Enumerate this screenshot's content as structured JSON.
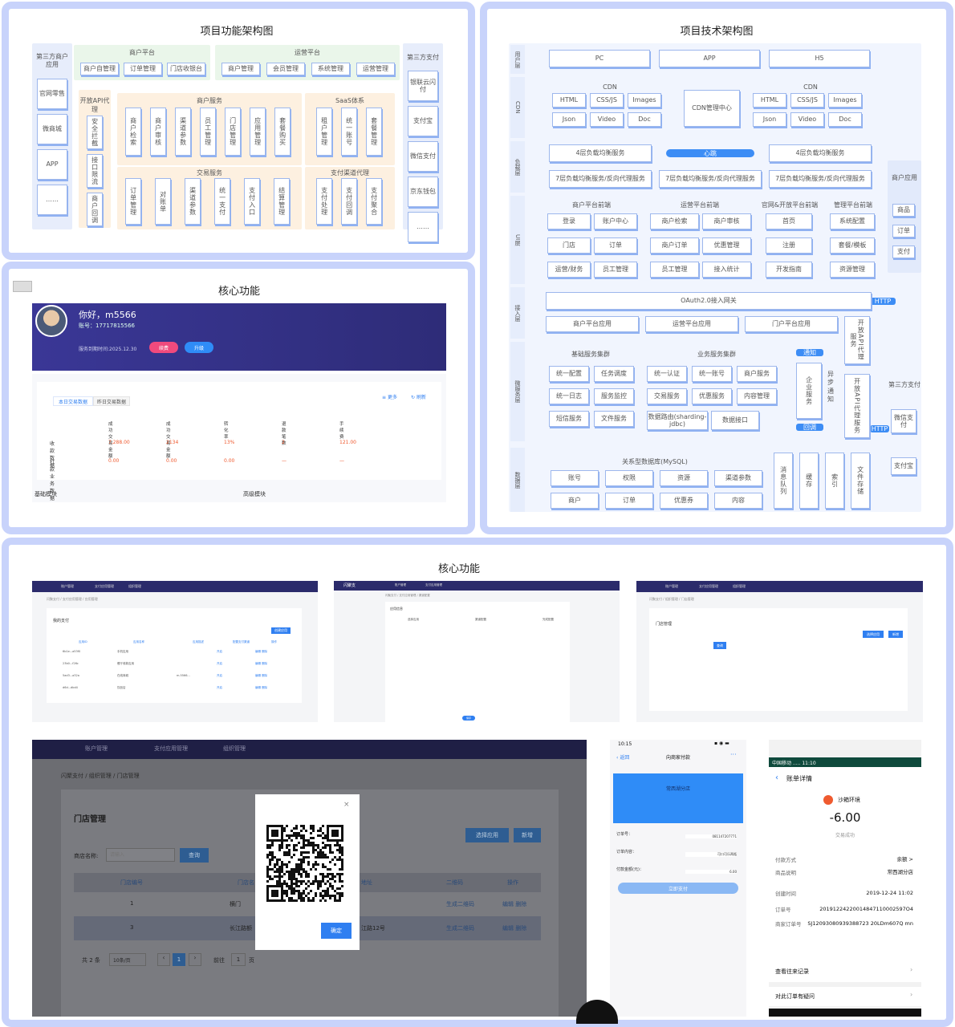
{
  "func": {
    "title": "项目功能架构图",
    "third": "第三方商户应用",
    "third_items": [
      "官网零售",
      "微商城",
      "APP",
      "……"
    ],
    "merchant_platform": "商户平台",
    "mp_items": [
      "商户自管理",
      "订单管理",
      "门店收银台"
    ],
    "ops_platform": "运营平台",
    "op_items": [
      "商户管理",
      "会员管理",
      "系统管理",
      "运营管理"
    ],
    "pay3": "第三方支付",
    "pay3_items": [
      "银联云闪付",
      "支付宝",
      "微信支付",
      "京东钱包",
      "……"
    ],
    "openapi": "开放API代理",
    "openapi_items": [
      "安全拦截",
      "接口限流",
      "商户回调"
    ],
    "merchant_service": "商户服务",
    "ms_items": [
      "商户检索",
      "商户审核",
      "渠道参数",
      "员工管理",
      "门店管理",
      "应用管理",
      "套餐购买"
    ],
    "saas": "SaaS体系",
    "saas_items": [
      "租户管理",
      "统一账号",
      "套餐管理"
    ],
    "trade": "交易服务",
    "trade_items": [
      "订单管理",
      "对账单",
      "渠道参数",
      "统一支付",
      "支付入口",
      "结算管理"
    ],
    "channel": "支付渠道代理",
    "channel_items": [
      "支付处理",
      "支付回调",
      "支付聚合"
    ]
  },
  "tech": {
    "title": "项目技术架构图",
    "layers": [
      "用户层",
      "CDN",
      "负载层",
      "UI层",
      "接入层",
      "微服务层",
      "数据层"
    ],
    "users": [
      "PC",
      "APP",
      "H5"
    ],
    "cdn_label": "CDN",
    "cdn_items": [
      "HTML",
      "CSS/JS",
      "Images",
      "Json",
      "Video",
      "Doc"
    ],
    "cdn_center": "CDN管理中心",
    "lb4": "4层负载均衡服务",
    "heartbeat": "心跳",
    "lb7": "7层负载均衡服务/反向代理服务",
    "ui_groups": [
      {
        "name": "商户平台前端",
        "items": [
          "登录",
          "账户中心",
          "门店",
          "订单",
          "运营/财务",
          "员工管理"
        ]
      },
      {
        "name": "运营平台前端",
        "items": [
          "商户检索",
          "商户审核",
          "商户订单",
          "优惠管理",
          "员工管理",
          "接入统计"
        ]
      },
      {
        "name": "官网&开放平台前端",
        "items": [
          "首页",
          "注册",
          "开发指南"
        ]
      },
      {
        "name": "管理平台前端",
        "items": [
          "系统配置",
          "套餐/模板",
          "资源管理"
        ]
      }
    ],
    "merchant_app": "商户应用",
    "app_items": [
      "商品",
      "订单",
      "支付"
    ],
    "oauth": "OAuth2.0接入网关",
    "http": "HTTP",
    "access": [
      "商户平台应用",
      "运营平台应用",
      "门户平台应用"
    ],
    "openapi_proxy": "开放API代理服务",
    "base_cluster": "基础服务集群",
    "base_items": [
      "统一配置",
      "任务调度",
      "统一日志",
      "服务监控",
      "短信服务",
      "文件服务"
    ],
    "biz_cluster": "业务服务集群",
    "biz_items": [
      "统一认证",
      "统一账号",
      "商户服务",
      "交易服务",
      "优惠服务",
      "内容管理",
      "数据路由(sharding-jdbc)",
      "数据接口"
    ],
    "enterprise": "企业服务",
    "async": "异步通知",
    "notice": "通知",
    "callback": "回调",
    "pay3": "第三方支付",
    "pay3_items": [
      "微信支付",
      "支付宝"
    ],
    "db": "关系型数据库(MySQL)",
    "db_items": [
      "账号",
      "权限",
      "资源",
      "渠道参数",
      "商户",
      "订单",
      "优惠券",
      "内容"
    ],
    "stores": [
      "消息队列",
      "缓存",
      "索引",
      "文件存储"
    ]
  },
  "core": {
    "title": "核心功能",
    "greeting": "你好，m5566",
    "account": "账号：17717815566",
    "expire": "服务到期时间:2025.12.30",
    "renew": "续费",
    "upgrade": "升级",
    "tabs": [
      "本日交易数据",
      "昨日交易数据"
    ],
    "more": "更多",
    "refresh": "刷新",
    "cols": [
      "成功交易金额",
      "成功交易金额",
      "转化率",
      "退款笔数",
      "手续费"
    ],
    "rows": [
      {
        "name": "收款数据",
        "vals": [
          "7,288.00",
          "2134",
          "13%",
          "2",
          "121.00"
        ]
      },
      {
        "name": "打款业务数据",
        "vals": [
          "0.00",
          "0.00",
          "0.00",
          "—",
          "—"
        ]
      }
    ],
    "left_module": "基础模块",
    "right_module": "高级模块"
  },
  "bottom": {
    "title": "核心功能",
    "shot1": {
      "nav": [
        "账户管理",
        "支付应用管理",
        "组织管理"
      ],
      "crumb": "闪聚支付 / 支付应用管理 / 应用管理",
      "heading": "我的支付",
      "create": "创建应用",
      "cols": [
        "应用ID",
        "应用名称",
        "应用描述",
        "配置支付渠道",
        "操作"
      ],
      "rows": [
        [
          "6b1e...a53f0",
          "手机应用",
          "",
          "开启",
          "编辑 删除"
        ],
        [
          "23b0...f26c",
          "餐厅收款应用",
          "",
          "开启",
          "编辑 删除"
        ],
        [
          "5ad3...a32a",
          "在线商城",
          "m.5566...",
          "开启",
          "编辑 删除"
        ],
        [
          "d6d...dbd4",
          "饮品店",
          "",
          "开启",
          "编辑 删除"
        ]
      ]
    },
    "shot2": {
      "logo": "闪聚支",
      "nav": [
        "账户管理",
        "支付应用管理"
      ],
      "crumb": "闪聚支付 / 支付应用管理 / 渠道配置",
      "heading": "应用信息",
      "steps": [
        "选择应用",
        "渠道配置",
        "完成配置"
      ],
      "button": "保存"
    },
    "shot3": {
      "nav": [
        "账户管理",
        "支付应用管理",
        "组织管理"
      ],
      "crumb": "闪聚支付 / 组织管理 / 门店管理",
      "heading": "门店管理",
      "btns": [
        "选择应用",
        "新增"
      ],
      "search": "查询"
    },
    "store": {
      "nav": [
        "账户管理",
        "支付应用管理",
        "组织管理"
      ],
      "crumb": "闪聚支付 / 组织管理 / 门店管理",
      "heading": "门店管理",
      "label": "商店名称:",
      "placeholder": "请输入",
      "search": "查询",
      "select_app": "选择应用",
      "add": "新增",
      "cols": [
        "门店编号",
        "门店名",
        "地址",
        "二维码",
        "操作"
      ],
      "rows": [
        [
          "1",
          "横门",
          "",
          "生成二维码",
          "编辑 删除"
        ],
        [
          "3",
          "长江路额",
          "江路12号",
          "生成二维码",
          "编辑 删除"
        ]
      ],
      "total": "共 2 条",
      "per": "10条/页",
      "page": "1",
      "goto": "前往",
      "goto_val": "1",
      "unit": "页",
      "confirm": "确定"
    },
    "mobile": {
      "time": "10:15",
      "back": "返回",
      "title": "向商家付款",
      "shop": "常西湖分店",
      "fields": [
        {
          "k": "订单号：",
          "v": "081147207771"
        },
        {
          "k": "订单内容：",
          "v": "可口可乐两瓶"
        },
        {
          "k": "付款金额(元)：",
          "v": "6.00"
        }
      ],
      "pay": "立即支付"
    },
    "bill": {
      "status": "中国移动 ..... 11:10",
      "title": "账单详情",
      "merchant": "沙箱环境",
      "amount": "-6.00",
      "result": "交易成功",
      "rows": [
        {
          "k": "付款方式",
          "v": "余额 >"
        },
        {
          "k": "商品说明",
          "v": "常西湖分店"
        },
        {
          "k": "创建时间",
          "v": "2019-12-24 11:02"
        },
        {
          "k": "订单号",
          "v": "20191224220014847110002597O4"
        },
        {
          "k": "商家订单号",
          "v": "SJ12093080939388723 20LDm607Q mn"
        }
      ],
      "records": "查看往来记录",
      "question": "对此订单有疑问"
    }
  },
  "colors": {
    "accent": "#3d8df5",
    "frame": "#c8d3fb",
    "banner": "#3a3796",
    "navy": "#2b2b6b",
    "orange": "#ef5a2f"
  }
}
